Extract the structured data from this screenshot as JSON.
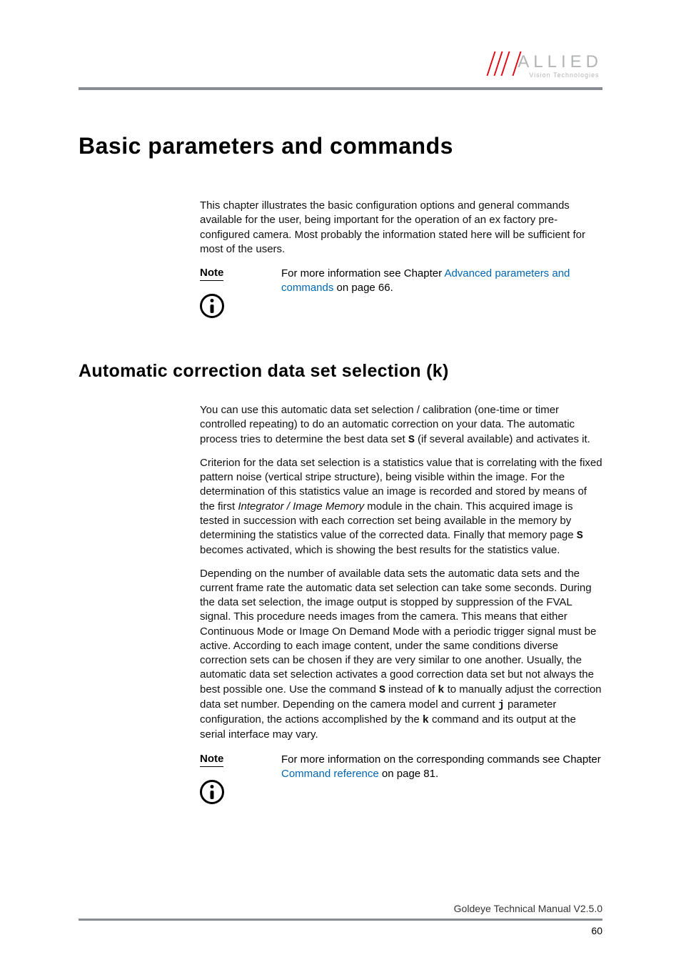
{
  "logo": {
    "main": "ALLIED",
    "sub": "Vision Technologies"
  },
  "h1": "Basic parameters and commands",
  "intro": "This chapter illustrates the basic configuration options and general commands available for the user, being important for the operation of an ex factory pre-configured camera. Most probably the information stated here will be sufficient for most of the users.",
  "note1": {
    "label": "Note",
    "pre": "For more information see Chapter ",
    "link": "Advanced parameters and commands",
    "post": " on page 66."
  },
  "h2": "Automatic correction data set selection (k)",
  "p1a": "You can use this automatic data set selection / calibration (one-time or timer controlled repeating) to do an automatic correction on your data. The automatic process tries to determine the best data set ",
  "p1_code1": "S",
  "p1b": " (if several available) and activates it.",
  "p2a": "Criterion for the data set selection is a statistics value that is correlating with the fixed pattern noise (vertical stripe structure), being visible within the image. For the determination of this statistics value an image is recorded and stored by means of the first ",
  "p2_italic": "Integrator / Image Memory",
  "p2b": " module in the chain. This acquired image is tested in succession with each correction set being available in the memory by determining the statistics value of the corrected data. Finally that memory page ",
  "p2_code1": "S",
  "p2c": " becomes activated, which is showing the best results for the statistics value.",
  "p3a": "Depending on the number of available data sets the automatic data sets and the current frame rate the automatic data set selection can take some seconds. During the data set selection, the image output is stopped by suppression of the FVAL signal. This procedure needs images from the camera. This means that either Continuous Mode or Image On Demand Mode with a periodic trigger signal must be active. According to each image content, under the same conditions diverse correction sets can be chosen if they are very similar to one another. Usually, the automatic data set selection activates a good correction data set but not always the best possible one. Use the command ",
  "p3_code1": "S",
  "p3b": " instead of ",
  "p3_code2": "k",
  "p3c": " to manually adjust the correction data set number. Depending on the camera model and current ",
  "p3_code3": "j",
  "p3d": " parameter configuration, the actions accomplished by the ",
  "p3_code4": "k",
  "p3e": " command and its output at the serial interface may vary.",
  "note2": {
    "label": "Note",
    "pre": "For more information on the corresponding commands see Chapter ",
    "link": "Command reference",
    "post": " on page 81."
  },
  "footer": {
    "title": "Goldeye Technical Manual V2.5.0",
    "page": "60"
  }
}
